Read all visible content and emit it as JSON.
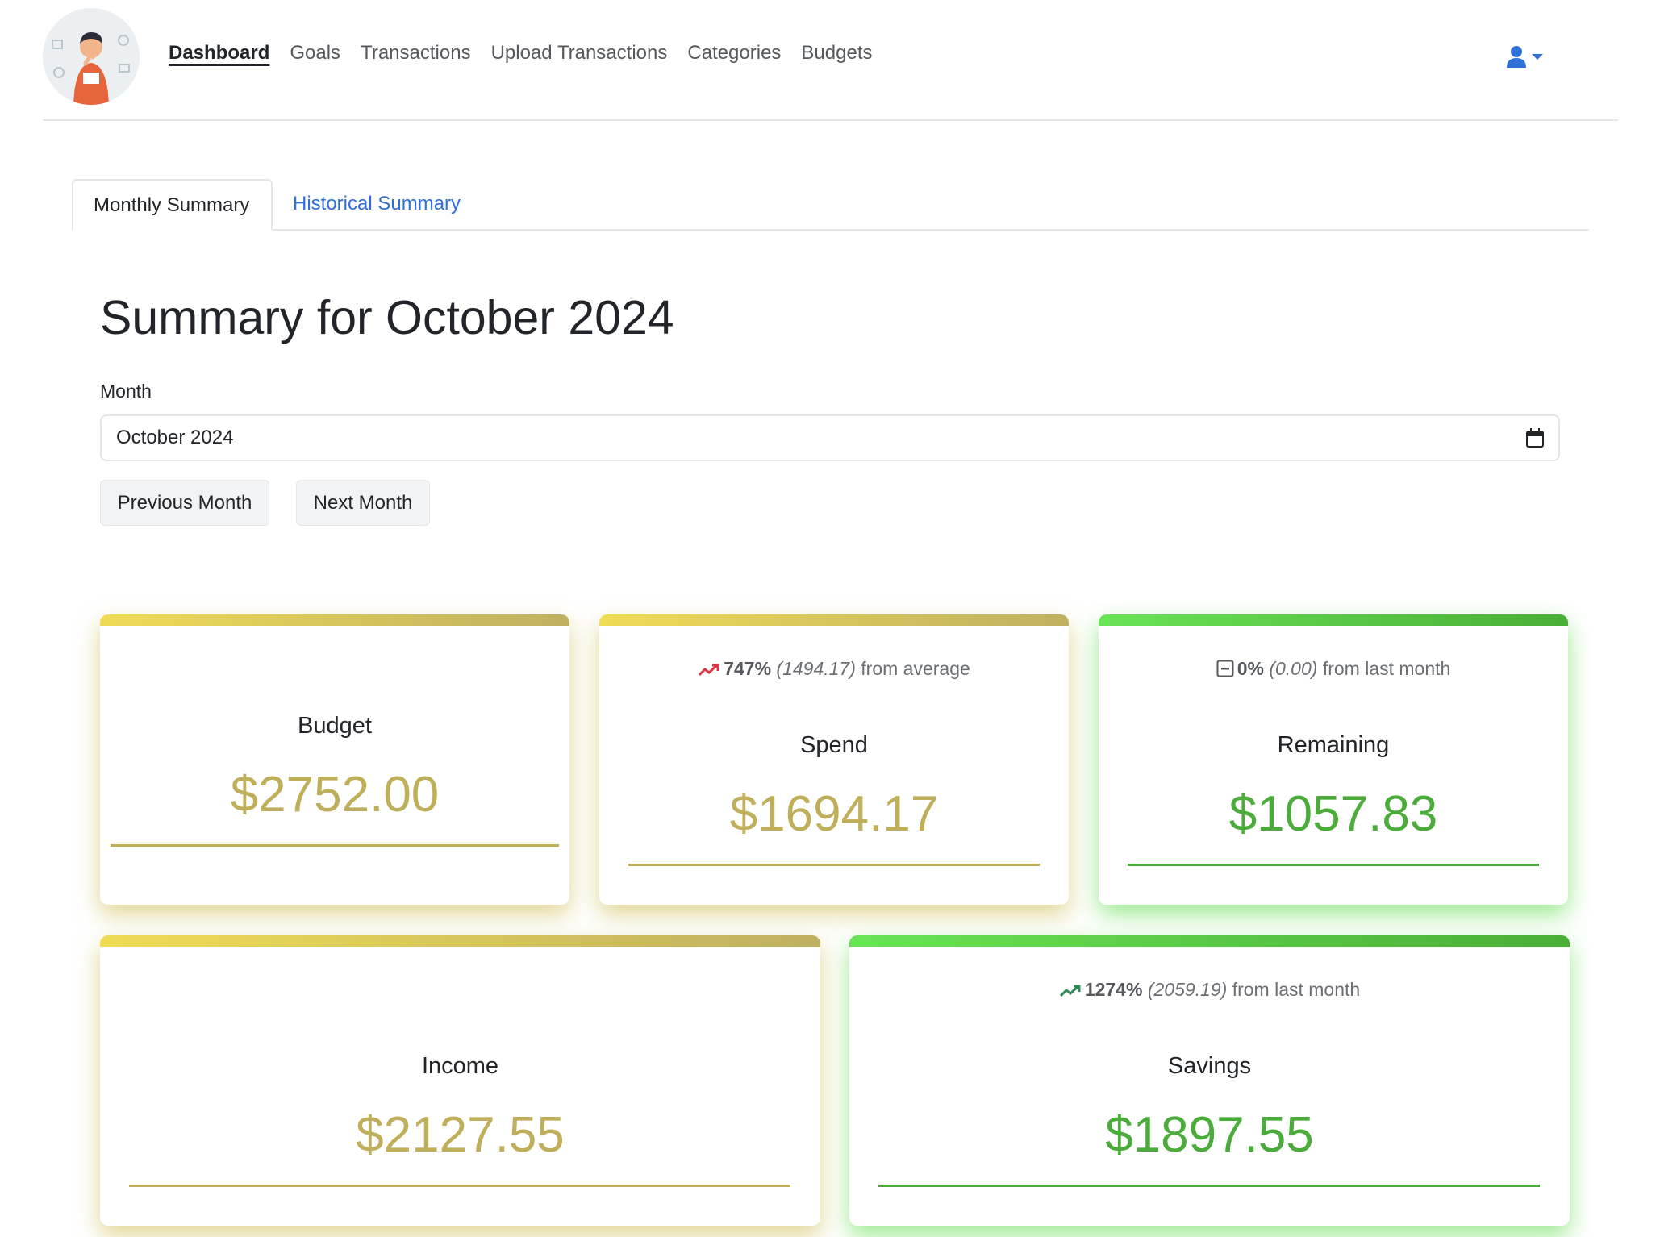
{
  "nav": {
    "items": [
      {
        "label": "Dashboard",
        "active": true
      },
      {
        "label": "Goals",
        "active": false
      },
      {
        "label": "Transactions",
        "active": false
      },
      {
        "label": "Upload Transactions",
        "active": false
      },
      {
        "label": "Categories",
        "active": false
      },
      {
        "label": "Budgets",
        "active": false
      }
    ],
    "user_icon": "user-icon",
    "accent_color": "#2f6fd8"
  },
  "tabs": [
    {
      "label": "Monthly Summary",
      "active": true
    },
    {
      "label": "Historical Summary",
      "active": false
    }
  ],
  "main": {
    "title": "Summary for October 2024",
    "month_label": "Month",
    "month_value": "October 2024",
    "prev_button": "Previous Month",
    "next_button": "Next Month"
  },
  "cards": {
    "budget": {
      "label": "Budget",
      "value": "$2752.00",
      "theme": "gold"
    },
    "spend": {
      "label": "Spend",
      "value": "$1694.17",
      "theme": "gold",
      "stat": {
        "icon": "trend-up-icon",
        "icon_color": "#dc3545",
        "percent": "747%",
        "amount": "(1494.17)",
        "suffix": "from average"
      }
    },
    "remaining": {
      "label": "Remaining",
      "value": "$1057.83",
      "theme": "green",
      "stat": {
        "icon": "square-minus-icon",
        "icon_color": "#55595e",
        "percent": "0%",
        "amount": "(0.00)",
        "suffix": "from last month"
      }
    },
    "income": {
      "label": "Income",
      "value": "$2127.55",
      "theme": "gold"
    },
    "savings": {
      "label": "Savings",
      "value": "$1897.55",
      "theme": "green",
      "stat": {
        "icon": "trend-up-icon",
        "icon_color": "#2e8b57",
        "percent": "1274%",
        "amount": "(2059.19)",
        "suffix": "from last month"
      }
    }
  },
  "colors": {
    "gold": "#bfae5a",
    "green": "#4bac3b"
  }
}
